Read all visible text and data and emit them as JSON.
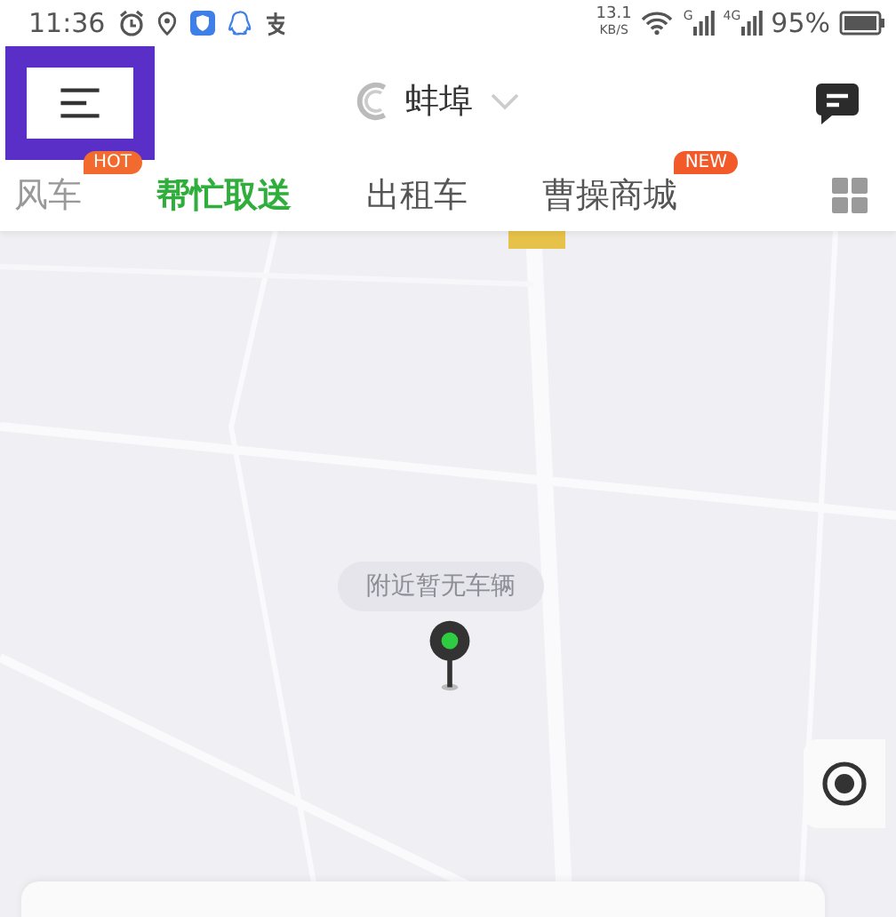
{
  "status_bar": {
    "time": "11:36",
    "speed": "13.1",
    "speed_unit": "KB/S",
    "sim_1": "G",
    "sim_2": "4G",
    "battery": "95%"
  },
  "header": {
    "menu_highlighted": true,
    "city": "蚌埠"
  },
  "tabs": [
    {
      "label": "风车",
      "selected": false,
      "badge": "HOT"
    },
    {
      "label": "帮忙取送",
      "selected": true
    },
    {
      "label": "出租车",
      "selected": false
    },
    {
      "label": "曹操商城",
      "selected": false,
      "badge": "NEW"
    }
  ],
  "map": {
    "kind": "picture",
    "notice": "附近暂无车辆"
  }
}
